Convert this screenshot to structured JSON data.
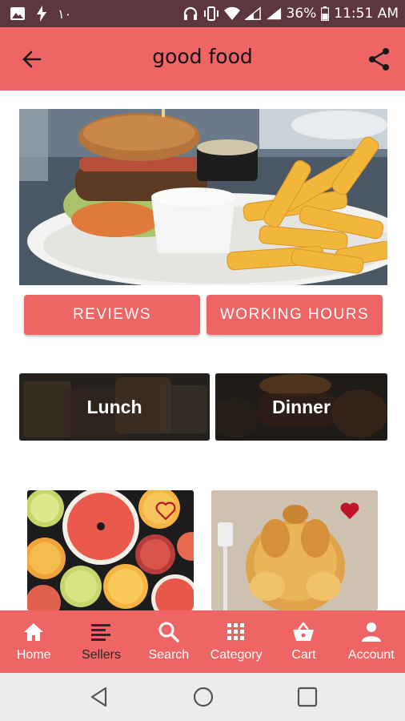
{
  "status": {
    "indicator_text": "١٠",
    "battery": "36%",
    "time": "11:51 AM"
  },
  "appbar": {
    "title": "good food"
  },
  "actions": {
    "reviews_label": "REVIEWS",
    "hours_label": "WORKING HOURS"
  },
  "categories": [
    {
      "label": "Lunch"
    },
    {
      "label": "Dinner"
    }
  ],
  "products": [
    {
      "favorite": false,
      "heart_style": "outline"
    },
    {
      "favorite": true,
      "heart_style": "filled"
    }
  ],
  "nav": {
    "items": [
      {
        "label": "Home",
        "icon": "home-icon"
      },
      {
        "label": "Sellers",
        "icon": "sellers-icon"
      },
      {
        "label": "Search",
        "icon": "search-icon"
      },
      {
        "label": "Category",
        "icon": "grid-icon"
      },
      {
        "label": "Cart",
        "icon": "basket-icon"
      },
      {
        "label": "Account",
        "icon": "person-icon"
      }
    ],
    "active_index": 1
  },
  "colors": {
    "accent": "#ef6464",
    "status_bar": "#5e3640",
    "button": "#ee6565",
    "heart": "#c0142a"
  }
}
